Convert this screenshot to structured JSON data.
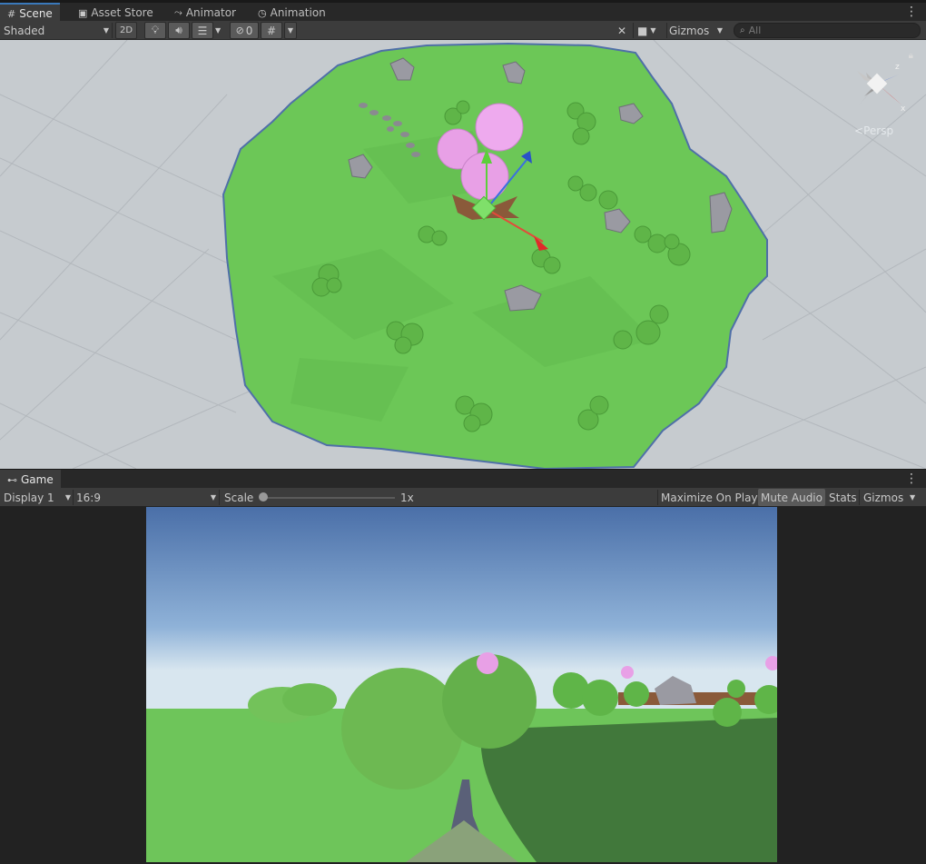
{
  "scene_tabs": [
    {
      "label": "Scene",
      "icon": "grid-icon",
      "active": true
    },
    {
      "label": "Asset Store",
      "icon": "bag-icon",
      "active": false
    },
    {
      "label": "Animator",
      "icon": "animator-icon",
      "active": false
    },
    {
      "label": "Animation",
      "icon": "clock-icon",
      "active": false
    }
  ],
  "scene_toolbar": {
    "draw_mode": "Shaded",
    "mode_2d": "2D",
    "hidden_count": "0",
    "gizmos": "Gizmos",
    "search_placeholder": "All"
  },
  "scene_view": {
    "projection_label": "Persp",
    "axis_x": "x",
    "axis_y": "y",
    "axis_z": "z"
  },
  "game_tab": {
    "label": "Game",
    "icon": "gamepad-icon"
  },
  "game_toolbar": {
    "display": "Display 1",
    "aspect": "16:9",
    "scale_label": "Scale",
    "scale_value": "1x",
    "scale_fraction": 0.0,
    "maximize_on_play": "Maximize On Play",
    "mute_audio": "Mute Audio",
    "stats": "Stats",
    "gizmos": "Gizmos"
  },
  "colors": {
    "editor_dark": "#282828",
    "toolbar": "#3c3c3c",
    "accent_blue": "#3a79bb",
    "ground_green": "#6cc757",
    "tree_pink": "#e8a0e6",
    "sky_top": "#4a6fa8"
  }
}
